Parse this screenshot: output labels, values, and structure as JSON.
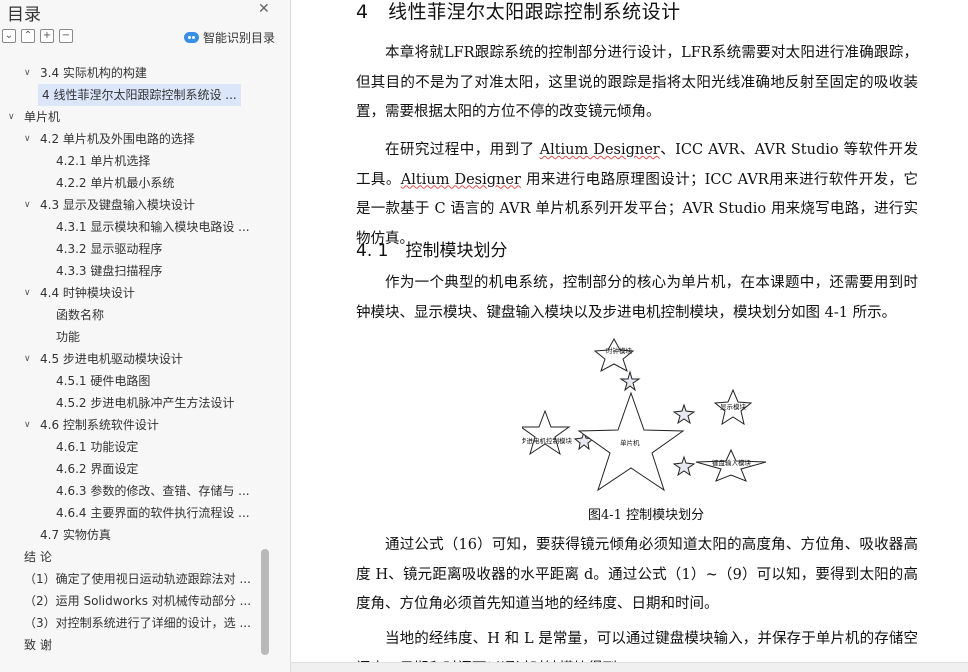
{
  "sidebar": {
    "title": "目录",
    "close_icon": "close-icon",
    "smart_toc_label": "智能识别目录",
    "toc": [
      {
        "level": 1,
        "arrow": "open",
        "label": "3.4 实际机构的构建"
      },
      {
        "level": 2,
        "arrow": "none",
        "label": "4 线性菲涅尔太阳跟踪控制系统设 ...",
        "selected": true
      },
      {
        "level": 0,
        "arrow": "open",
        "label": "单片机"
      },
      {
        "level": 1,
        "arrow": "open",
        "label": "4.2 单片机及外围电路的选择"
      },
      {
        "level": 2,
        "arrow": "none",
        "label": "4.2.1 单片机选择"
      },
      {
        "level": 2,
        "arrow": "none",
        "label": "4.2.2 单片机最小系统"
      },
      {
        "level": 1,
        "arrow": "open",
        "label": "4.3 显示及键盘输入模块设计"
      },
      {
        "level": 2,
        "arrow": "none",
        "label": "4.3.1 显示模块和输入模块电路设 ..."
      },
      {
        "level": 2,
        "arrow": "none",
        "label": "4.3.2 显示驱动程序"
      },
      {
        "level": 2,
        "arrow": "none",
        "label": "4.3.3 键盘扫描程序"
      },
      {
        "level": 1,
        "arrow": "open",
        "label": "4.4 时钟模块设计"
      },
      {
        "level": 2,
        "arrow": "none",
        "label": "函数名称"
      },
      {
        "level": 2,
        "arrow": "none",
        "label": "功能"
      },
      {
        "level": 1,
        "arrow": "open",
        "label": "4.5 步进电机驱动模块设计"
      },
      {
        "level": 2,
        "arrow": "none",
        "label": "4.5.1 硬件电路图"
      },
      {
        "level": 2,
        "arrow": "none",
        "label": "4.5.2 步进电机脉冲产生方法设计"
      },
      {
        "level": 1,
        "arrow": "open",
        "label": "4.6 控制系统软件设计"
      },
      {
        "level": 2,
        "arrow": "none",
        "label": "4.6.1 功能设定"
      },
      {
        "level": 2,
        "arrow": "none",
        "label": "4.6.2 界面设定"
      },
      {
        "level": 2,
        "arrow": "none",
        "label": "4.6.3 参数的修改、查错、存储与 ..."
      },
      {
        "level": 2,
        "arrow": "none",
        "label": "4.6.4 主要界面的软件执行流程设 ..."
      },
      {
        "level": 1,
        "arrow": "none",
        "label": "4.7 实物仿真"
      },
      {
        "level": 0,
        "arrow": "none",
        "label": "结 论"
      },
      {
        "level": 0,
        "arrow": "none",
        "label": "（1）确定了使用视日运动轨迹跟踪法对 ..."
      },
      {
        "level": 0,
        "arrow": "none",
        "label": "（2）运用 Solidworks 对机械传动部分 ..."
      },
      {
        "level": 0,
        "arrow": "none",
        "label": "（3）对控制系统进行了详细的设计，选 ..."
      },
      {
        "level": 0,
        "arrow": "none",
        "label": "致 谢"
      }
    ]
  },
  "document": {
    "heading1": "4　线性菲涅尔太阳跟踪控制系统设计",
    "para1": "本章将就LFR跟踪系统的控制部分进行设计，LFR系统需要对太阳进行准确跟踪，但其目的不是为了对准太阳，这里说的跟踪是指将太阳光线准确地反射至固定的吸收装置，需要根据太阳的方位不停的改变镜元倾角。",
    "para2_a": "在研究过程中，用到了 ",
    "para2_altium1": "Altium Designer",
    "para2_b": "、ICC AVR、AVR Studio 等软件开发工具。",
    "para2_altium2": "Altium Designer",
    "para2_c": " 用来进行电路原理图设计；ICC AVR用来进行软件开发，它是一款基于 C 语言的 AVR 单片机系列开发平台；AVR Studio 用来烧写电路，进行实物仿真。",
    "heading2": "4. 1　控制模块划分",
    "para3": "作为一个典型的机电系统，控制部分的核心为单片机，在本课题中，还需要用到时钟模块、显示模块、键盘输入模块以及步进电机控制模块，模块划分如图 4-1 所示。",
    "figure": {
      "center_label": "单片机",
      "top_label": "时钟模块",
      "right_label": "显示模块",
      "left_label": "步进电机控制模块",
      "bottom_right_label": "键盘输入模块"
    },
    "caption": "图4-1 控制模块划分",
    "para4": "通过公式（16）可知，要获得镜元倾角必须知道太阳的高度角、方位角、吸收器高度 H、镜元距离吸收器的水平距离 d。通过公式（1）~（9）可以知，要得到太阳的高度角、方位角必须首先知道当地的经纬度、日期和时间。",
    "para5": "当地的经纬度、H 和 L 是常量，可以通过键盘模块输入，并保存于单片机的存储空间中。日期和时间可以通过时钟模块得到。"
  },
  "colors": {
    "selected_bg": "#dbe6fb",
    "accent": "#3a8ee6",
    "wavy_underline": "#e05050"
  }
}
